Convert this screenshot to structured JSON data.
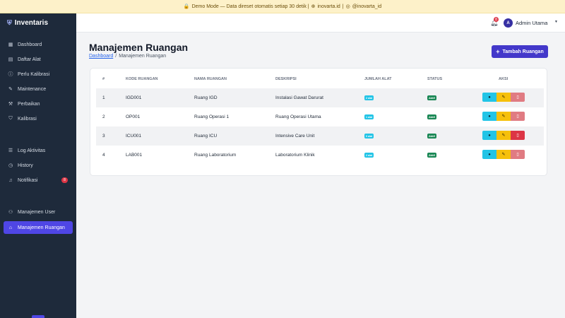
{
  "banner": {
    "icon": "lock-icon",
    "text": "Demo Mode — Data direset otomatis setiap 30 detik |",
    "link1_icon": "globe-icon",
    "link1": "inovarta.id",
    "separator": "|",
    "link2_icon": "instagram-icon",
    "link2": "@inovarta_id"
  },
  "sidebar": {
    "brand": "Inventaris",
    "brand_icon": "shield-icon",
    "items": [
      {
        "label": "Dashboard",
        "icon": "dashboard-icon"
      },
      {
        "label": "Daftar Alat",
        "icon": "list-icon"
      },
      {
        "label": "Perlu Kalibrasi",
        "icon": "alert-icon"
      },
      {
        "label": "Maintenance",
        "icon": "wrench-icon"
      },
      {
        "label": "Perbaikan",
        "icon": "tool-icon"
      },
      {
        "label": "Kalibrasi",
        "icon": "check-shield-icon"
      },
      {
        "label": "Log Aktivitas",
        "icon": "log-icon"
      },
      {
        "label": "History",
        "icon": "clock-icon"
      },
      {
        "label": "Notifikasi",
        "icon": "bell-icon",
        "badge": "8"
      },
      {
        "label": "Manajemen User",
        "icon": "users-icon"
      },
      {
        "label": "Manajemen Ruangan",
        "icon": "building-icon",
        "active": true
      }
    ]
  },
  "topbar": {
    "notification_count": "8",
    "avatar_initial": "A",
    "user_name": "Admin Utama"
  },
  "page": {
    "title": "Manajemen Ruangan",
    "breadcrumb": {
      "home": "Dashboard",
      "separator": "/",
      "current": "Manajemen Ruangan"
    },
    "add_button": "Tambah Ruangan"
  },
  "table": {
    "headers": [
      "#",
      "KODE RUANGAN",
      "NAMA RUANGAN",
      "DESKRIPSI",
      "JUMLAH ALAT",
      "STATUS",
      "AKSI"
    ],
    "rows": [
      {
        "no": "1",
        "kode": "IGD001",
        "nama": "Ruang IGD",
        "deskripsi": "Instalasi Gawat Darurat",
        "jumlah": "2 alat",
        "status": "Aktif"
      },
      {
        "no": "2",
        "kode": "OP001",
        "nama": "Ruang Operasi 1",
        "deskripsi": "Ruang Operasi Utama",
        "jumlah": "1 alat",
        "status": "Aktif"
      },
      {
        "no": "3",
        "kode": "ICU001",
        "nama": "Ruang ICU",
        "deskripsi": "Intensive Care Unit",
        "jumlah": "0 alat",
        "status": "Aktif"
      },
      {
        "no": "4",
        "kode": "LAB001",
        "nama": "Ruang Laboratorium",
        "deskripsi": "Laboratorium Klinik",
        "jumlah": "2 alat",
        "status": "Aktif"
      }
    ]
  },
  "colors": {
    "sidebar_bg": "#1e2a3b",
    "accent": "#4f46e5",
    "info": "#22c4e6",
    "success": "#198754",
    "warning": "#f6c00b",
    "danger": "#dc3545"
  }
}
